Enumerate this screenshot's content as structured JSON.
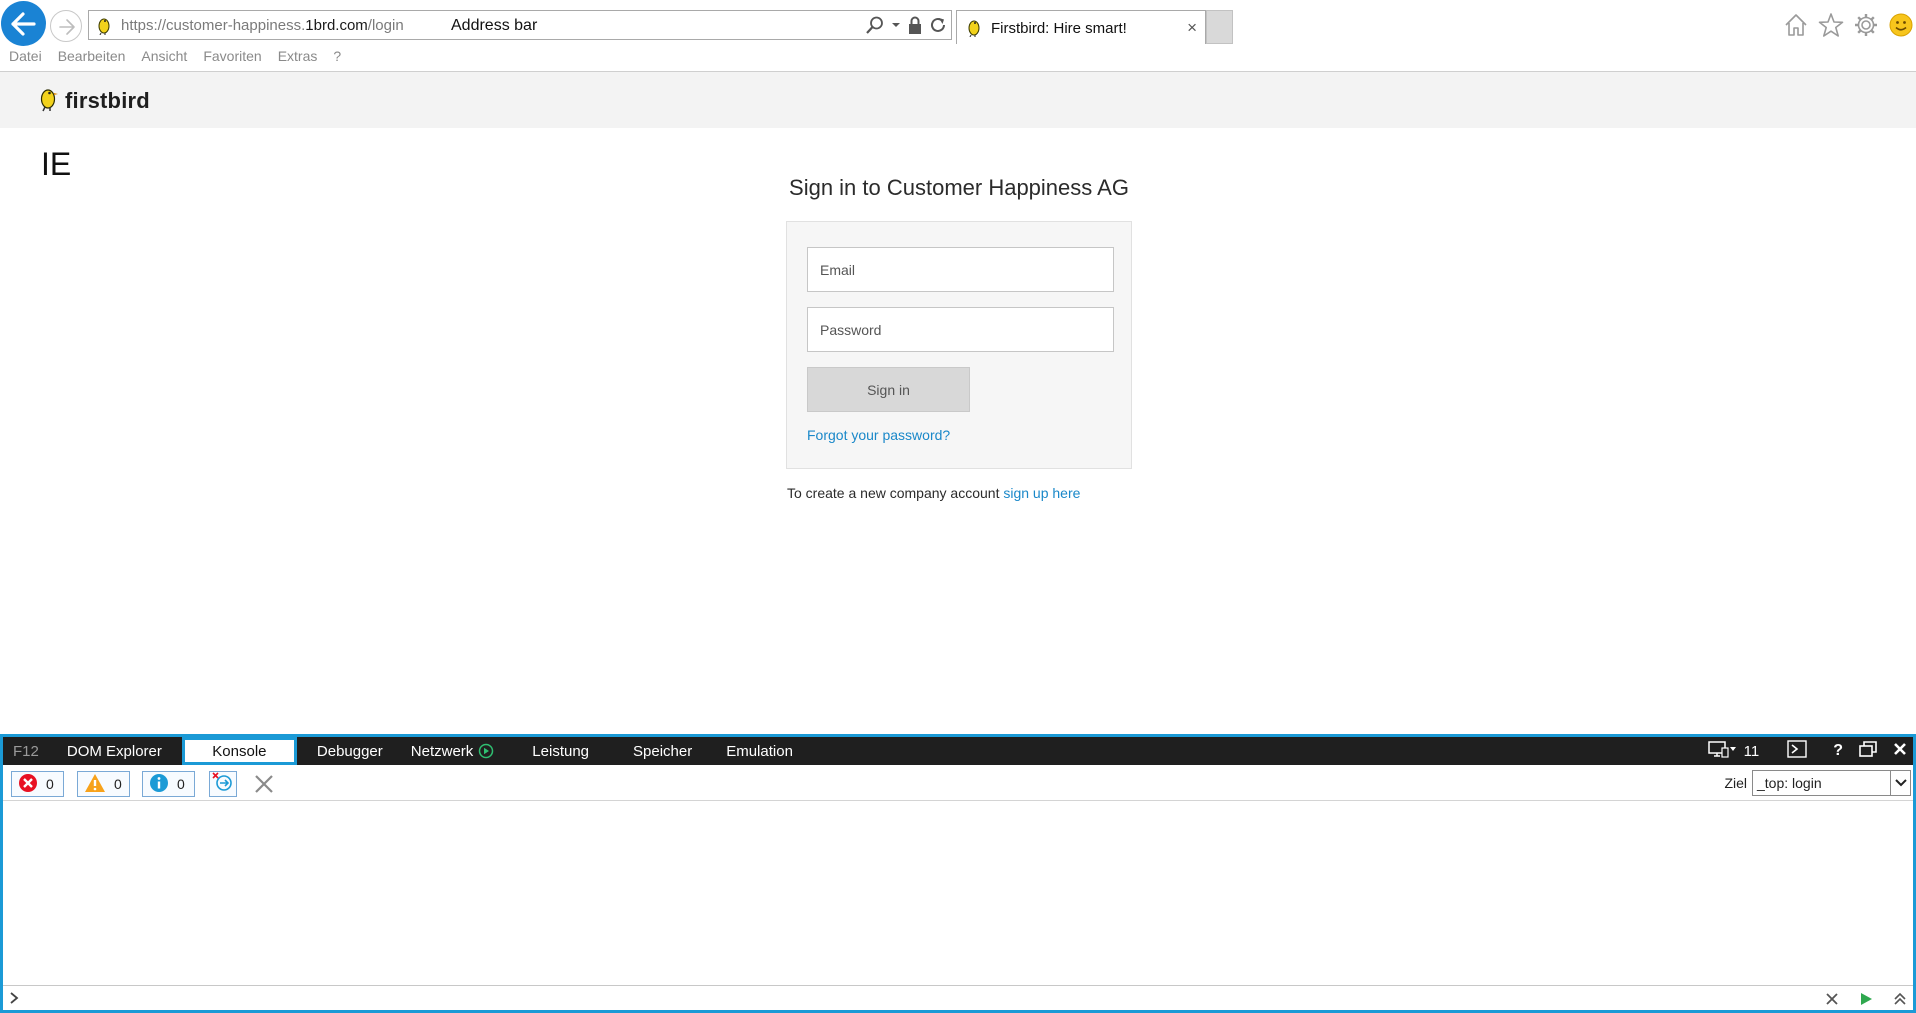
{
  "browser": {
    "url_prefix": "https://customer-happiness.",
    "url_domain": "1brd.com",
    "url_path": "/login",
    "address_bar_annotation": "Address bar",
    "tab_title": "Firstbird: Hire smart!",
    "tab_close": "×",
    "menu": [
      "Datei",
      "Bearbeiten",
      "Ansicht",
      "Favoriten",
      "Extras",
      "?"
    ]
  },
  "site": {
    "brand": "firstbird",
    "ie_label": "IE",
    "signin_title": "Sign in to Customer Happiness AG",
    "email_placeholder": "Email",
    "password_placeholder": "Password",
    "signin_button": "Sign in",
    "forgot_link": "Forgot your password?",
    "create_text": "To create a new company account ",
    "signup_link": "sign up here"
  },
  "devtools": {
    "tabs": {
      "f12": "F12",
      "dom": "DOM Explorer",
      "console": "Konsole",
      "debugger": "Debugger",
      "network": "Netzwerk",
      "performance": "Leistung",
      "memory": "Speicher",
      "emulation": "Emulation"
    },
    "document_mode": "11",
    "errors": "0",
    "warnings": "0",
    "messages": "0",
    "target_label": "Ziel",
    "target_value": "_top: login"
  },
  "colors": {
    "accent": "#1b9ad6",
    "link": "#1a88c9",
    "ie_blue": "#1a83d4",
    "brand_yellow": "#f2d21b"
  }
}
